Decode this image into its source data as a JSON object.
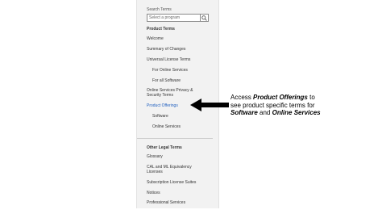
{
  "sidebar": {
    "search_label": "Search Terms",
    "search_placeholder": "Select a program",
    "product_terms_heading": "Product Terms",
    "items": [
      {
        "label": "Welcome"
      },
      {
        "label": "Summary of Changes"
      },
      {
        "label": "Universal License Terms"
      },
      {
        "label": "For Online Services"
      },
      {
        "label": "For all Software"
      },
      {
        "label": "Online Services Privacy & Security Terms"
      },
      {
        "label": "Product Offerings"
      },
      {
        "label": "Software"
      },
      {
        "label": "Online Services"
      }
    ],
    "other_heading": "Other Legal Terms",
    "other_items": [
      {
        "label": "Glossary"
      },
      {
        "label": "CAL and ML Equivalency Licenses"
      },
      {
        "label": "Subscription License Suites"
      },
      {
        "label": "Notices"
      },
      {
        "label": "Professional Services"
      }
    ]
  },
  "callout": {
    "line1_prefix": "Access ",
    "line1_bold": "Product Offerings",
    "line1_suffix": " to",
    "line2": "see product specific terms for",
    "line3_bold1": "Software",
    "line3_mid": " and ",
    "line3_bold2": "Online Services"
  },
  "colors": {
    "sidebar_bg": "#f2f2f2",
    "active_link": "#1f5fbf",
    "arrow": "#000000"
  },
  "icons": {
    "search": "search-icon",
    "arrow": "left-arrow-icon"
  }
}
